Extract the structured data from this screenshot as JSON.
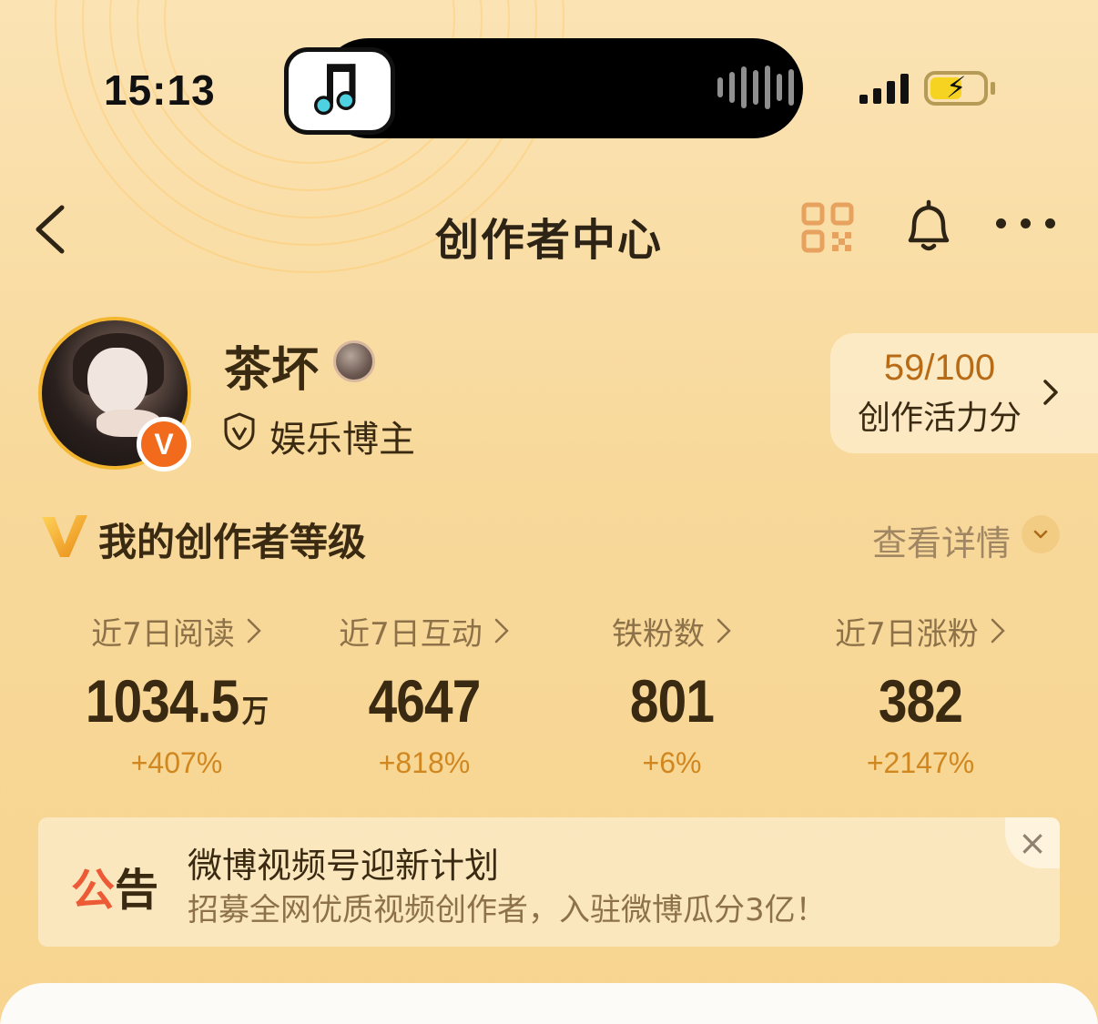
{
  "status_bar": {
    "time": "15:13",
    "music_icon": "music-note-icon",
    "signal_icon": "cellular-signal-icon",
    "battery_icon": "battery-charging-icon",
    "battery_color": "#f7d321"
  },
  "nav": {
    "back_icon": "chevron-left-icon",
    "title": "创作者中心",
    "qr_icon": "qr-code-icon",
    "bell_icon": "bell-icon",
    "more_icon": "more-icon"
  },
  "profile": {
    "username": "茶坏",
    "verified_badge": "V",
    "role": "娱乐博主",
    "score": {
      "value": "59/100",
      "label": "创作活力分"
    }
  },
  "level": {
    "title": "我的创作者等级",
    "detail_label": "查看详情"
  },
  "stats": [
    {
      "label": "近7日阅读",
      "value": "1034.5",
      "unit": "万",
      "change": "+407%"
    },
    {
      "label": "近7日互动",
      "value": "4647",
      "unit": "",
      "change": "+818%"
    },
    {
      "label": "铁粉数",
      "value": "801",
      "unit": "",
      "change": "+6%"
    },
    {
      "label": "近7日涨粉",
      "value": "382",
      "unit": "",
      "change": "+2147%"
    }
  ],
  "notice": {
    "tag_first": "公",
    "tag_second": "告",
    "title": "微博视频号迎新计划",
    "subtitle": "招募全网优质视频创作者，入驻微博瓜分3亿！",
    "close": "×"
  },
  "colors": {
    "accent_orange": "#f26a1b",
    "score_color": "#b76b16",
    "change_color": "#d1871f",
    "notice_red": "#ec5a36"
  }
}
